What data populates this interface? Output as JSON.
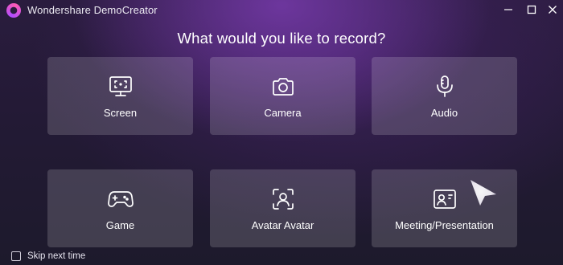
{
  "window": {
    "title": "Wondershare DemoCreator",
    "controls": [
      "minimize-icon",
      "maximize-icon",
      "close-icon"
    ]
  },
  "heading": "What would you like to record?",
  "options": [
    {
      "label": "Screen",
      "icon": "screen-capture-icon"
    },
    {
      "label": "Camera",
      "icon": "camera-icon"
    },
    {
      "label": "Audio",
      "icon": "microphone-icon"
    },
    {
      "label": "Game",
      "icon": "gamepad-icon"
    },
    {
      "label": "Avatar Avatar",
      "icon": "avatar-scan-icon"
    },
    {
      "label": "Meeting/Presentation",
      "icon": "presentation-icon"
    }
  ],
  "footer": {
    "skip_label": "Skip next time",
    "skip_checked": false
  },
  "colors": {
    "background": "#231a35",
    "accent": "#b04cff",
    "card": "rgba(255,255,255,0.16)"
  }
}
